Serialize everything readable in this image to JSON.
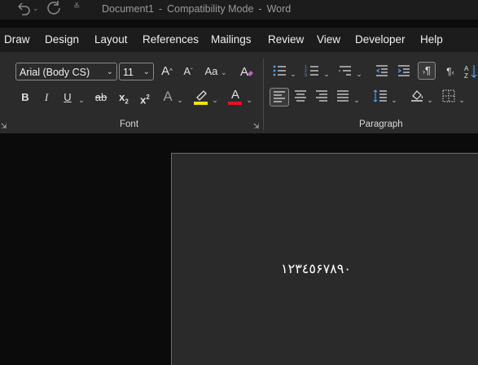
{
  "window": {
    "doc_name": "Document1",
    "separator": "-",
    "mode": "Compatibility Mode",
    "app": "Word"
  },
  "menu": {
    "tabs": [
      "Draw",
      "Design",
      "Layout",
      "References",
      "Mailings",
      "Review",
      "View",
      "Developer",
      "Help"
    ]
  },
  "font_group": {
    "label": "Font",
    "font_name": "Arial (Body CS)",
    "font_size": "11",
    "change_case": "Aa",
    "bold": "B",
    "italic": "I",
    "underline": "U",
    "strike": "ab",
    "subscript": "x",
    "superscript": "x",
    "text_effects": "A",
    "font_color": "A",
    "highlight_color": "#f5e400",
    "font_color_hex": "#e81123"
  },
  "paragraph_group": {
    "label": "Paragraph",
    "ltr": "¶",
    "rtl": "¶"
  },
  "document": {
    "text": "١٢٣٤٥۶٧٨٩٠"
  },
  "colors": {
    "ribbon": "#2b2b2b",
    "background": "#0b0b0b",
    "page": "#2a2a2a"
  }
}
